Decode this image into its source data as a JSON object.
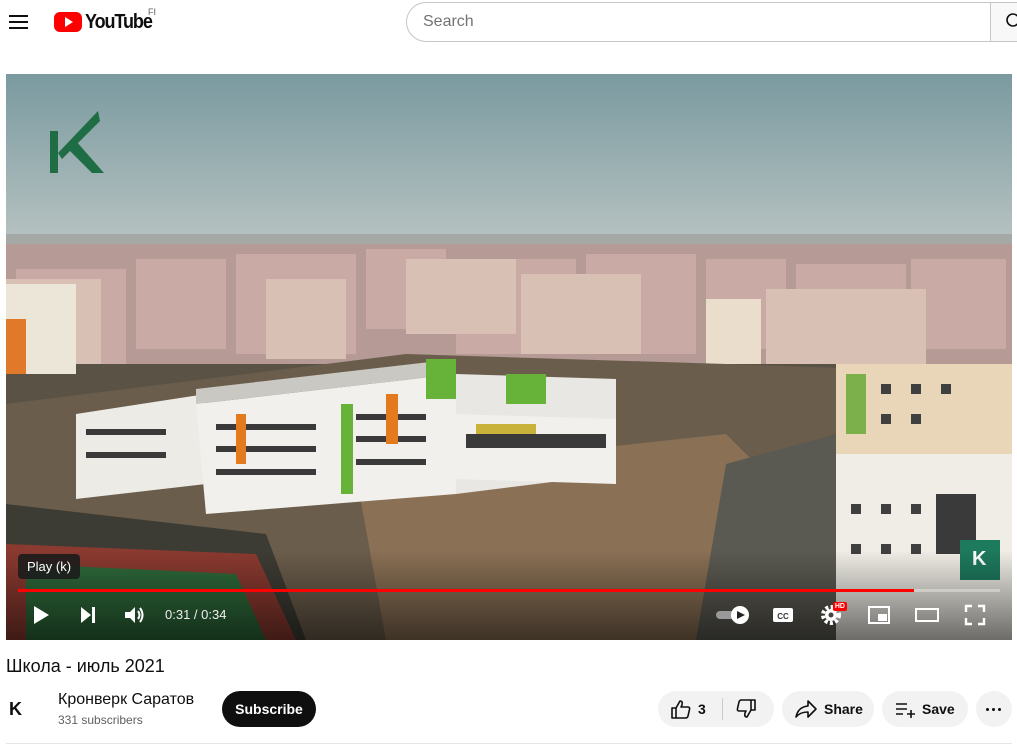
{
  "masthead": {
    "logo_text": "YouTube",
    "country_code": "FI",
    "search_placeholder": "Search"
  },
  "player": {
    "tooltip": "Play (k)",
    "current_time": "0:31",
    "duration": "0:34",
    "time_display": "0:31 / 0:34",
    "progress_fraction": 0.912,
    "watermark_letter": "K",
    "hd_badge": "HD",
    "accent_color": "#ff0000"
  },
  "video": {
    "title": "Школа - июль 2021"
  },
  "owner": {
    "channel_name": "Кронверк Саратов",
    "subscribers": "331 subscribers",
    "avatar_letter": "K",
    "subscribe_label": "Subscribe"
  },
  "actions": {
    "like_count": "3",
    "share_label": "Share",
    "save_label": "Save"
  },
  "icons": [
    "menu-icon",
    "youtube-logo-icon",
    "search-icon",
    "play-icon",
    "next-icon",
    "volume-icon",
    "autoplay-toggle-icon",
    "captions-icon",
    "settings-icon",
    "miniplayer-icon",
    "theater-icon",
    "fullscreen-icon",
    "like-icon",
    "dislike-icon",
    "share-icon",
    "save-icon",
    "more-icon"
  ]
}
